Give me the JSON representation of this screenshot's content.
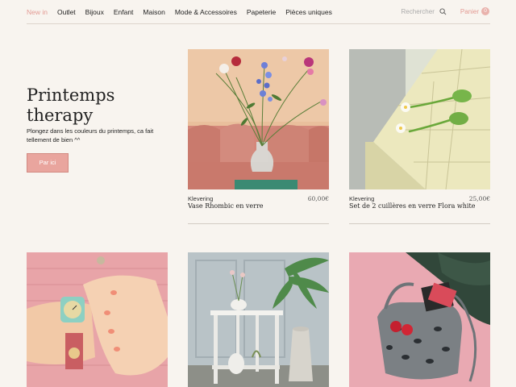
{
  "nav": {
    "links": [
      "New in",
      "Outlet",
      "Bijoux",
      "Enfant",
      "Maison",
      "Mode & Accessoires",
      "Papeterie",
      "Pièces uniques"
    ],
    "search_label": "Rechercher",
    "cart_label": "Panier",
    "cart_count": "0"
  },
  "hero": {
    "title_line1": "Printemps",
    "title_line2": "therapy",
    "subtitle": "Plongez dans les couleurs du printemps, ca fait tellement de bien ^^",
    "button_label": "Par ici"
  },
  "products": [
    {
      "brand": "Klevering",
      "price": "60,00€",
      "name": "Vase Rhombic en verre"
    },
    {
      "brand": "Klevering",
      "price": "25,00€",
      "name": "Set de 2 cuillères en verre Flora white"
    }
  ],
  "colors": {
    "accent": "#e39a93",
    "button": "#e9a59e",
    "background": "#f8f4ef"
  }
}
